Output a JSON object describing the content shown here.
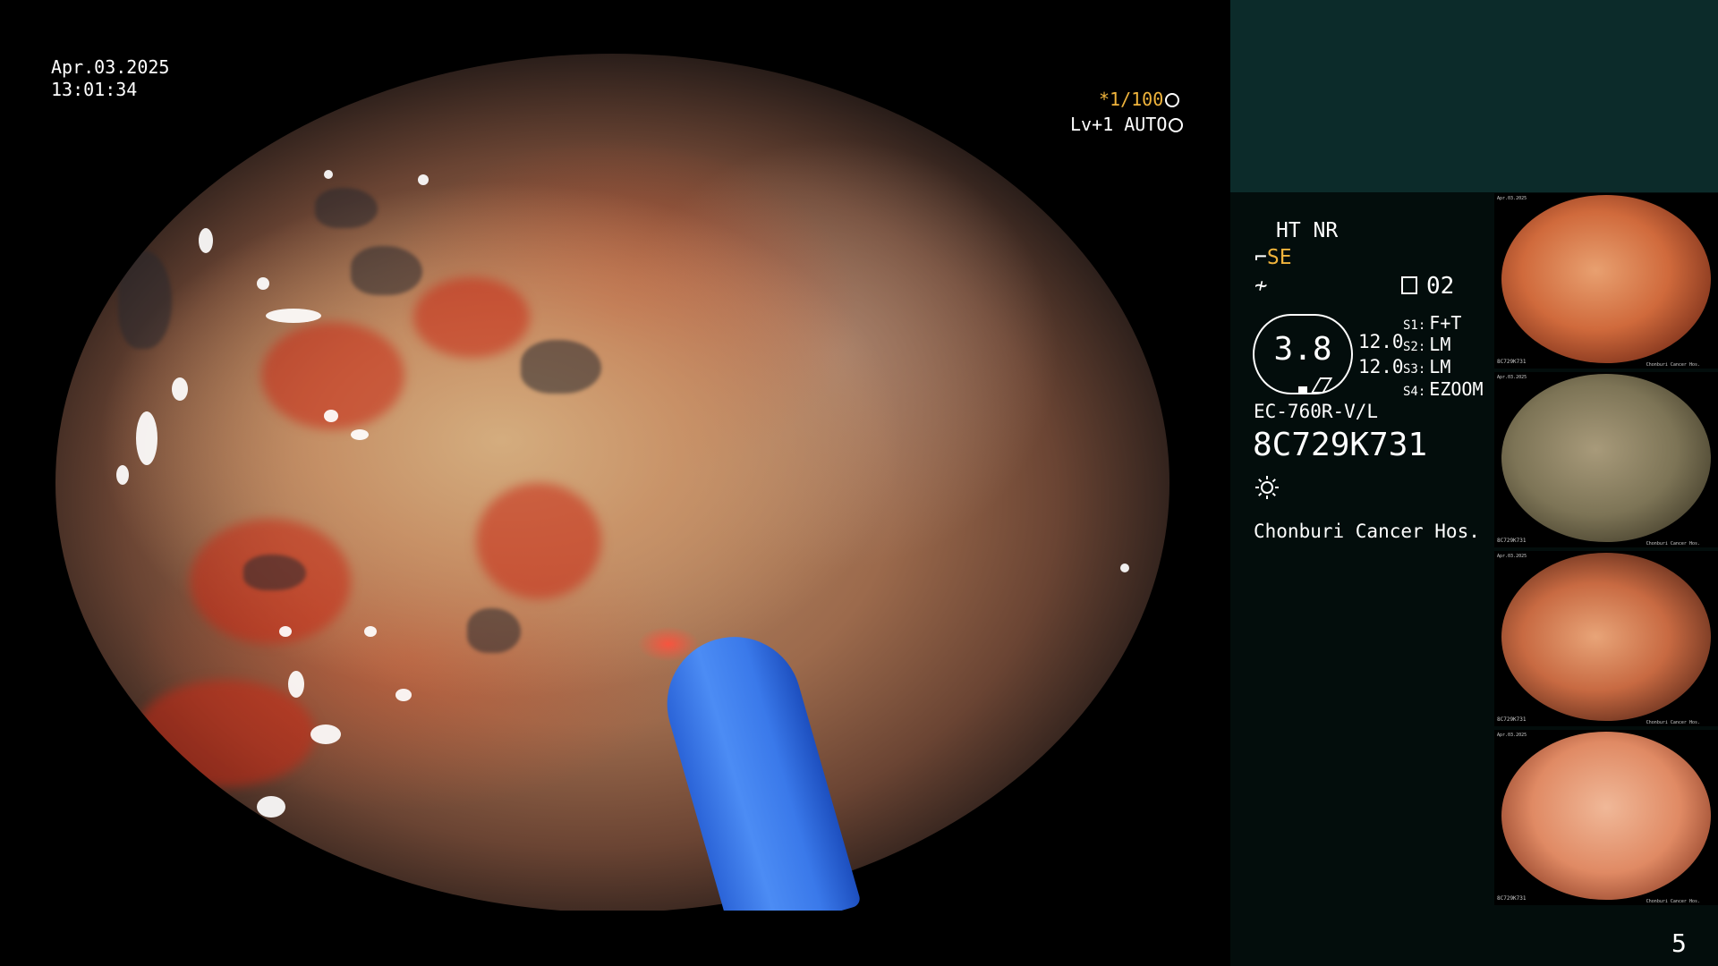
{
  "overlay": {
    "date": "Apr.03.2025",
    "time": "13:01:34",
    "shutter": "*1/100",
    "level": "Lv+1 AUTO"
  },
  "panel": {
    "ht_nr": "HT NR",
    "se": "SE",
    "memory": "02",
    "octagon_value": "3.8",
    "value1": "12.0",
    "value2": "12.0",
    "s_settings": [
      {
        "key": "S1:",
        "value": "F+T"
      },
      {
        "key": "S2:",
        "value": "LM"
      },
      {
        "key": "S3:",
        "value": "LM"
      },
      {
        "key": "S4:",
        "value": "EZOOM"
      }
    ],
    "scope_model": "EC-760R-V/L",
    "serial": "8C729K731",
    "hospital": "Chonburi Cancer Hos.",
    "page_number": "5"
  },
  "thumbnails": [
    {
      "top_text": "Apr.03.2025",
      "bottom_text": "8C729K731",
      "bottom_right": "Chonburi Cancer Hos."
    },
    {
      "top_text": "Apr.03.2025",
      "bottom_text": "8C729K731",
      "bottom_right": "Chonburi Cancer Hos."
    },
    {
      "top_text": "Apr.03.2025",
      "bottom_text": "8C729K731",
      "bottom_right": "Chonburi Cancer Hos."
    },
    {
      "top_text": "Apr.03.2025",
      "bottom_text": "8C729K731",
      "bottom_right": "Chonburi Cancer Hos."
    }
  ],
  "colors": {
    "accent_amber": "#f0b43c",
    "panel_bg": "#030d0c",
    "panel_top_bg": "#0c2b2a"
  },
  "icons": [
    "shutter-icon",
    "level-icon",
    "enhance-icon",
    "memory-icon",
    "light-icon"
  ]
}
